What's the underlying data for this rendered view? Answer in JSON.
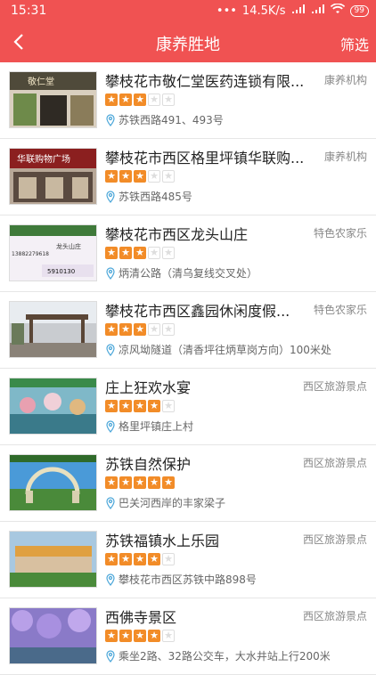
{
  "status": {
    "time": "15:31",
    "speed": "14.5K/s",
    "battery": "99"
  },
  "nav": {
    "title": "康养胜地",
    "filter_label": "筛选"
  },
  "colors": {
    "accent": "#f05252",
    "star": "#f28c28"
  },
  "items": [
    {
      "name": "攀枝花市敬仁堂医药连锁有限...",
      "category": "康养机构",
      "rating": 3,
      "address": "苏铁西路491、493号",
      "thumb_sign": "敬仁堂"
    },
    {
      "name": "攀枝花市西区格里坪镇华联购...",
      "category": "康养机构",
      "rating": 3,
      "address": "苏铁西路485号",
      "thumb_sign": "华联购物广场"
    },
    {
      "name": "攀枝花市西区龙头山庄",
      "category": "特色农家乐",
      "rating": 3,
      "address": "炳清公路（清乌复线交叉处）",
      "thumb_sign": "龙头山庄 5910130"
    },
    {
      "name": "攀枝花市西区鑫园休闲度假...",
      "category": "特色农家乐",
      "rating": 3,
      "address": "凉风坳隧道（清香坪往炳草岗方向）100米处",
      "thumb_sign": ""
    },
    {
      "name": "庄上狂欢水宴",
      "category": "西区旅游景点",
      "rating": 4,
      "address": "格里坪镇庄上村",
      "thumb_sign": ""
    },
    {
      "name": "苏铁自然保护",
      "category": "西区旅游景点",
      "rating": 5,
      "address": "巴关河西岸的丰家梁子",
      "thumb_sign": ""
    },
    {
      "name": "苏铁福镇水上乐园",
      "category": "西区旅游景点",
      "rating": 4,
      "address": "攀枝花市西区苏铁中路898号",
      "thumb_sign": ""
    },
    {
      "name": "西佛寺景区",
      "category": "西区旅游景点",
      "rating": 4,
      "address": "乘坐2路、32路公交车，大水井站上行200米",
      "thumb_sign": ""
    }
  ]
}
